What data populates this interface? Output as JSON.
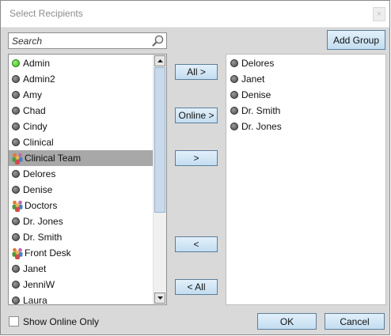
{
  "window": {
    "title": "Select Recipients",
    "close_glyph": "×"
  },
  "search": {
    "placeholder": "Search"
  },
  "buttons": {
    "add_group": "Add Group",
    "all_right": "All >",
    "online_right": "Online >",
    "move_right": ">",
    "move_left": "<",
    "all_left": "< All",
    "ok": "OK",
    "cancel": "Cancel"
  },
  "available": [
    {
      "name": "Admin",
      "status": "online",
      "icon": "status-dot-icon"
    },
    {
      "name": "Admin2",
      "status": "offline",
      "icon": "status-dot-icon"
    },
    {
      "name": "Amy",
      "status": "offline",
      "icon": "status-dot-icon"
    },
    {
      "name": "Chad",
      "status": "offline",
      "icon": "status-dot-icon"
    },
    {
      "name": "Cindy",
      "status": "offline",
      "icon": "status-dot-icon"
    },
    {
      "name": "Clinical",
      "status": "offline",
      "icon": "status-dot-icon"
    },
    {
      "name": "Clinical Team",
      "status": "group",
      "icon": "group-icon",
      "selected": true
    },
    {
      "name": "Delores",
      "status": "offline",
      "icon": "status-dot-icon"
    },
    {
      "name": "Denise",
      "status": "offline",
      "icon": "status-dot-icon"
    },
    {
      "name": "Doctors",
      "status": "group",
      "icon": "group-icon"
    },
    {
      "name": "Dr. Jones",
      "status": "offline",
      "icon": "status-dot-icon"
    },
    {
      "name": "Dr. Smith",
      "status": "offline",
      "icon": "status-dot-icon"
    },
    {
      "name": "Front Desk",
      "status": "group",
      "icon": "group-icon"
    },
    {
      "name": "Janet",
      "status": "offline",
      "icon": "status-dot-icon"
    },
    {
      "name": "JenniW",
      "status": "offline",
      "icon": "status-dot-icon"
    },
    {
      "name": "Laura",
      "status": "offline",
      "icon": "status-dot-icon"
    }
  ],
  "selected": [
    {
      "name": "Delores",
      "status": "offline"
    },
    {
      "name": "Janet",
      "status": "offline"
    },
    {
      "name": "Denise",
      "status": "offline"
    },
    {
      "name": "Dr. Smith",
      "status": "offline"
    },
    {
      "name": "Dr. Jones",
      "status": "offline"
    }
  ],
  "footer": {
    "show_online_only": "Show Online Only",
    "show_online_checked": false
  },
  "colors": {
    "online": "#35b81e",
    "offline": "#4a4a4a",
    "selected_row": "#a8a8a8",
    "button": "#c3ddf0"
  }
}
